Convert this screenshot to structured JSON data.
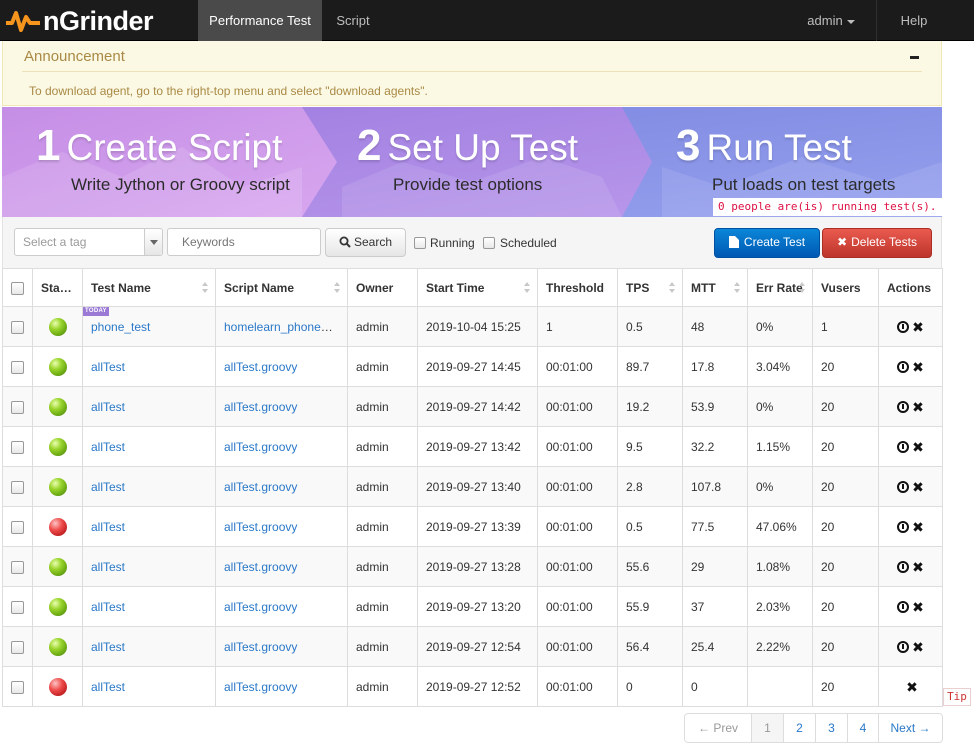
{
  "navbar": {
    "brand": "nGrinder",
    "items": [
      {
        "label": "Performance Test",
        "active": true
      },
      {
        "label": "Script",
        "active": false
      }
    ],
    "user": "admin",
    "help": "Help"
  },
  "announcement": {
    "title": "Announcement",
    "text": "To download agent, go to the right-top menu and select \"download agents\"."
  },
  "banner": {
    "steps": [
      {
        "num": "1",
        "title": "Create Script",
        "subtitle": "Write Jython or Groovy script"
      },
      {
        "num": "2",
        "title": "Set Up Test",
        "subtitle": "Provide test options"
      },
      {
        "num": "3",
        "title": "Run Test",
        "subtitle": "Put loads on test targets"
      }
    ],
    "running_msg": "0 people are(is) running test(s)."
  },
  "toolbar": {
    "tag_placeholder": "Select a tag",
    "keyword_placeholder": "Keywords",
    "search_label": "Search",
    "running_label": "Running",
    "scheduled_label": "Scheduled",
    "create_label": "Create Test",
    "delete_label": "Delete Tests"
  },
  "table": {
    "headers": [
      "Status",
      "Test Name",
      "Script Name",
      "Owner",
      "Start Time",
      "Threshold",
      "TPS",
      "MTT",
      "Err Rate",
      "Vusers",
      "Actions"
    ],
    "today_tag": "TODAY",
    "rows": [
      {
        "status": "green",
        "name": "phone_test",
        "script": "homelearn_phone_test.groovy",
        "owner": "admin",
        "start": "2019-10-04 15:25",
        "threshold": "1",
        "tps": "0.5",
        "mtt": "48",
        "err": "0%",
        "vusers": "1",
        "today": true,
        "stop": true
      },
      {
        "status": "green",
        "name": "allTest",
        "script": "allTest.groovy",
        "owner": "admin",
        "start": "2019-09-27 14:45",
        "threshold": "00:01:00",
        "tps": "89.7",
        "mtt": "17.8",
        "err": "3.04%",
        "vusers": "20",
        "today": false,
        "stop": true
      },
      {
        "status": "green",
        "name": "allTest",
        "script": "allTest.groovy",
        "owner": "admin",
        "start": "2019-09-27 14:42",
        "threshold": "00:01:00",
        "tps": "19.2",
        "mtt": "53.9",
        "err": "0%",
        "vusers": "20",
        "today": false,
        "stop": true
      },
      {
        "status": "green",
        "name": "allTest",
        "script": "allTest.groovy",
        "owner": "admin",
        "start": "2019-09-27 13:42",
        "threshold": "00:01:00",
        "tps": "9.5",
        "mtt": "32.2",
        "err": "1.15%",
        "vusers": "20",
        "today": false,
        "stop": true
      },
      {
        "status": "green",
        "name": "allTest",
        "script": "allTest.groovy",
        "owner": "admin",
        "start": "2019-09-27 13:40",
        "threshold": "00:01:00",
        "tps": "2.8",
        "mtt": "107.8",
        "err": "0%",
        "vusers": "20",
        "today": false,
        "stop": true
      },
      {
        "status": "red",
        "name": "allTest",
        "script": "allTest.groovy",
        "owner": "admin",
        "start": "2019-09-27 13:39",
        "threshold": "00:01:00",
        "tps": "0.5",
        "mtt": "77.5",
        "err": "47.06%",
        "vusers": "20",
        "today": false,
        "stop": true
      },
      {
        "status": "green",
        "name": "allTest",
        "script": "allTest.groovy",
        "owner": "admin",
        "start": "2019-09-27 13:28",
        "threshold": "00:01:00",
        "tps": "55.6",
        "mtt": "29",
        "err": "1.08%",
        "vusers": "20",
        "today": false,
        "stop": true
      },
      {
        "status": "green",
        "name": "allTest",
        "script": "allTest.groovy",
        "owner": "admin",
        "start": "2019-09-27 13:20",
        "threshold": "00:01:00",
        "tps": "55.9",
        "mtt": "37",
        "err": "2.03%",
        "vusers": "20",
        "today": false,
        "stop": true
      },
      {
        "status": "green",
        "name": "allTest",
        "script": "allTest.groovy",
        "owner": "admin",
        "start": "2019-09-27 12:54",
        "threshold": "00:01:00",
        "tps": "56.4",
        "mtt": "25.4",
        "err": "2.22%",
        "vusers": "20",
        "today": false,
        "stop": true
      },
      {
        "status": "red",
        "name": "allTest",
        "script": "allTest.groovy",
        "owner": "admin",
        "start": "2019-09-27 12:52",
        "threshold": "00:01:00",
        "tps": "0",
        "mtt": "0",
        "err": "",
        "vusers": "20",
        "today": false,
        "stop": false
      }
    ]
  },
  "tip": "Tip",
  "pagination": {
    "prev": "← Prev",
    "pages": [
      "1",
      "2",
      "3",
      "4"
    ],
    "current": "1",
    "next": "Next →"
  },
  "colors": {
    "navbar_bg": "#1b1b1b",
    "accent_blue": "#0a76cc",
    "accent_red": "#d9534f",
    "link": "#2a78c8",
    "logo_orange": "#f5951e"
  }
}
